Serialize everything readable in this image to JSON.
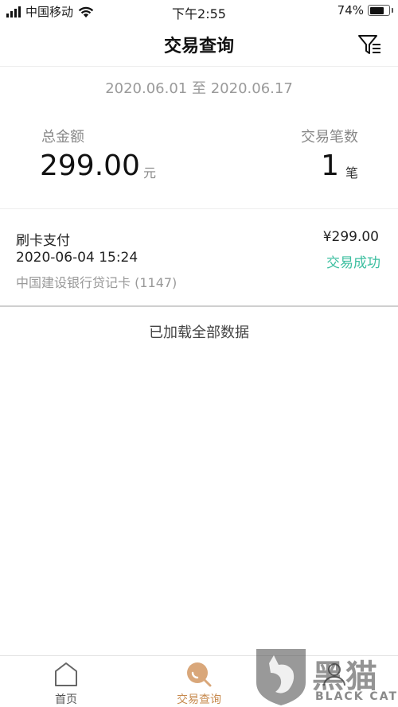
{
  "status_bar": {
    "carrier": "中国移动",
    "time": "下午2:55",
    "battery": "74%",
    "battery_level": 0.74
  },
  "nav": {
    "title": "交易查询",
    "filter_icon": "filter-icon"
  },
  "date_range": "2020.06.01 至 2020.06.17",
  "summary": {
    "total_label": "总金额",
    "total_value": "299.00",
    "total_unit": "元",
    "count_label": "交易笔数",
    "count_value": "1",
    "count_unit": "笔"
  },
  "transactions": [
    {
      "type": "刷卡支付",
      "datetime": "2020-06-04 15:24",
      "card": "中国建设银行贷记卡 (1147)",
      "amount": "¥299.00",
      "status": "交易成功",
      "status_color": "#3dbfa0"
    }
  ],
  "list_footer": "已加载全部数据",
  "tabbar": {
    "items": [
      {
        "label": "首页",
        "icon": "home-icon"
      },
      {
        "label": "交易查询",
        "icon": "search-icon",
        "active": true,
        "color": "#c78a4e"
      },
      {
        "label": "",
        "icon": "person-icon"
      }
    ]
  },
  "watermark": {
    "cn_text": "黑猫",
    "en_text": "BLACK CAT"
  }
}
